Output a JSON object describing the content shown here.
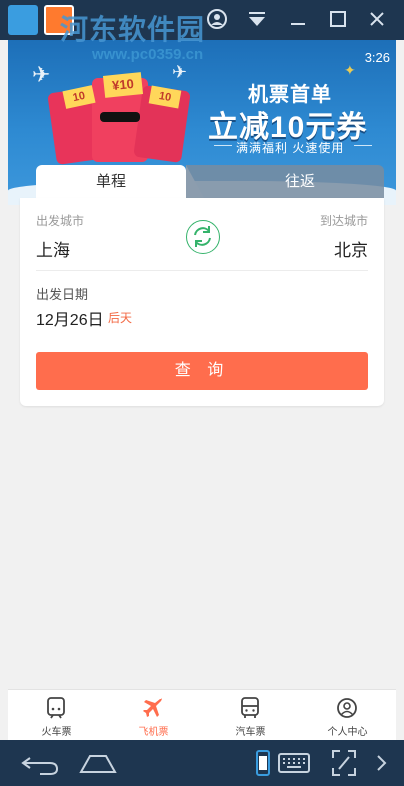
{
  "watermark": {
    "title": "河东软件园",
    "url": "www.pc0359.cn"
  },
  "status": {
    "time": "3:26"
  },
  "banner": {
    "line1": "机票首单",
    "line2": "立减10元券",
    "line3": "满满福利 火速使用",
    "coupon_value": "10",
    "yen": "¥"
  },
  "trip_tabs": {
    "one_way": "单程",
    "round_trip": "往返"
  },
  "search_form": {
    "depart_label": "出发城市",
    "depart_city": "上海",
    "arrive_label": "到达城市",
    "arrive_city": "北京",
    "date_label": "出发日期",
    "date_value": "12月26日",
    "relative_day": "后天",
    "query_button": "查 询"
  },
  "bottom_tabs": [
    {
      "label": "火车票",
      "icon": "train-icon",
      "active": false
    },
    {
      "label": "飞机票",
      "icon": "plane-icon",
      "active": true
    },
    {
      "label": "汽车票",
      "icon": "bus-icon",
      "active": false
    },
    {
      "label": "个人中心",
      "icon": "user-icon",
      "active": false
    }
  ],
  "colors": {
    "accent": "#ff6d4d",
    "active_tab": "#ff6d4d",
    "swap": "#35b36b",
    "banner": "#2e8ad2",
    "emulator_chrome": "#1e3650"
  }
}
